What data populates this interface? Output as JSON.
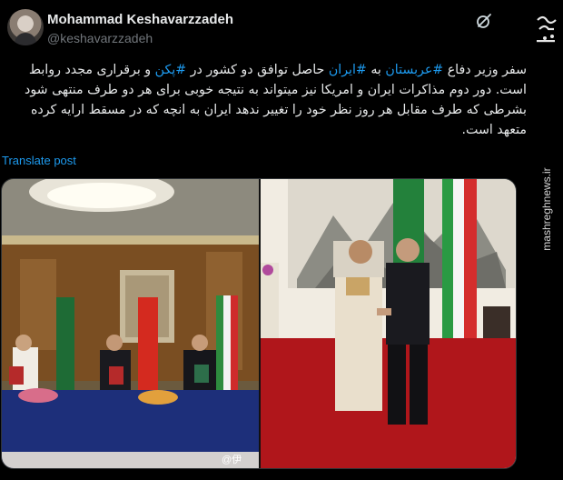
{
  "header": {
    "display_name": "Mohammad Keshavarzzadeh",
    "handle": "@keshavarzzadeh"
  },
  "watermark": {
    "site": "mashreghnews.ir"
  },
  "tweet": {
    "seg1": "سفر وزیر دفاع ",
    "hashtag1": "#عربستان",
    "seg2": " به ",
    "hashtag2": "#ایران",
    "seg3": " حاصل توافق دو کشور در ",
    "hashtag3": "#پکن",
    "seg4": " و برقراری مجدد روابط است. دور دوم  مذاکرات ایران و امریکا نیز میتواند به نتیجه خوبی برای هر دو طرف منتهی شود بشرطی که طرف مقابل هر روز نظر خود را تغییر ندهد ایران به انچه که در مسقط ارایه کرده متعهد است."
  },
  "translate_label": "Translate post",
  "media": {
    "weibo_credit": "@伊"
  },
  "icons": {
    "grok": "grok-icon",
    "watermark_logo": "mashregh-logo"
  },
  "colors": {
    "background": "#000000",
    "text": "#e7e9ea",
    "link": "#1d9bf0",
    "muted": "#71767b"
  }
}
